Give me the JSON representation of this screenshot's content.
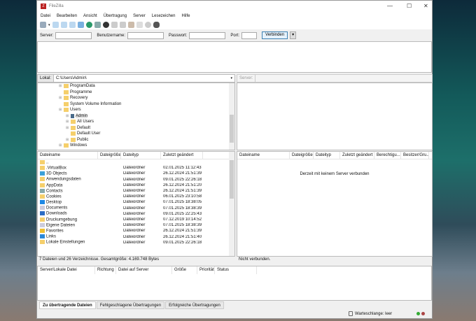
{
  "app": {
    "title": "FileZilla"
  },
  "menu": [
    "Datei",
    "Bearbeiten",
    "Ansicht",
    "Übertragung",
    "Server",
    "Lesezeichen",
    "Hilfe"
  ],
  "quickconnect": {
    "server_label": "Server:",
    "user_label": "Benutzername:",
    "pass_label": "Passwort:",
    "port_label": "Port:",
    "connect": "Verbinden",
    "server": "",
    "user": "",
    "pass": "",
    "port": ""
  },
  "local": {
    "label": "Lokal:",
    "path": "C:\\Users\\Admin\\",
    "tree": [
      {
        "name": "ProgramData",
        "level": 1,
        "exp": "+"
      },
      {
        "name": "Programme",
        "level": 1,
        "exp": ""
      },
      {
        "name": "Recovery",
        "level": 1,
        "exp": "+"
      },
      {
        "name": "System Volume Information",
        "level": 1,
        "exp": ""
      },
      {
        "name": "Users",
        "level": 1,
        "exp": "-"
      },
      {
        "name": "Admin",
        "level": 2,
        "exp": "+",
        "user": true
      },
      {
        "name": "All Users",
        "level": 2,
        "exp": "+"
      },
      {
        "name": "Default",
        "level": 2,
        "exp": "+"
      },
      {
        "name": "Default User",
        "level": 2,
        "exp": ""
      },
      {
        "name": "Public",
        "level": 2,
        "exp": "+"
      },
      {
        "name": "Windows",
        "level": 1,
        "exp": "+"
      }
    ],
    "columns": [
      "Dateiname",
      "Dateigröße",
      "Dateityp",
      "Zuletzt geändert"
    ],
    "files": [
      {
        "name": "..",
        "type": "",
        "date": ""
      },
      {
        "name": ".VirtualBox",
        "type": "Dateiordner",
        "date": "02.01.2025 11:12:43"
      },
      {
        "name": "3D Objects",
        "type": "Dateiordner",
        "date": "26.12.2024 21:51:39"
      },
      {
        "name": "Anwendungsdaten",
        "type": "Dateiordner",
        "date": "09.01.2025 22:26:18"
      },
      {
        "name": "AppData",
        "type": "Dateiordner",
        "date": "26.12.2024 21:51:20"
      },
      {
        "name": "Contacts",
        "type": "Dateiordner",
        "date": "26.12.2024 21:51:39"
      },
      {
        "name": "Cookies",
        "type": "Dateiordner",
        "date": "06.01.2025 23:10:58"
      },
      {
        "name": "Desktop",
        "type": "Dateiordner",
        "date": "07.01.2025 18:38:05"
      },
      {
        "name": "Documents",
        "type": "Dateiordner",
        "date": "07.01.2025 18:38:39"
      },
      {
        "name": "Downloads",
        "type": "Dateiordner",
        "date": "09.01.2025 22:25:43"
      },
      {
        "name": "Druckumgebung",
        "type": "Dateiordner",
        "date": "07.12.2019 10:14:52"
      },
      {
        "name": "Eigene Dateien",
        "type": "Dateiordner",
        "date": "07.01.2025 18:38:39"
      },
      {
        "name": "Favorites",
        "type": "Dateiordner",
        "date": "26.12.2024 21:51:39"
      },
      {
        "name": "Links",
        "type": "Dateiordner",
        "date": "26.12.2024 21:51:40"
      },
      {
        "name": "Lokale Einstellungen",
        "type": "Dateiordner",
        "date": "09.01.2025 22:26:18"
      }
    ],
    "status": "7 Dateien und 26 Verzeichnisse. Gesamtgröße: 4.169.748 Bytes"
  },
  "remote": {
    "label": "Server:",
    "columns": [
      "Dateiname",
      "Dateigröße",
      "Dateityp",
      "Zuletzt geändert",
      "Berechtigu...",
      "Besitzer/Gru..."
    ],
    "empty": "Derzeit mit keinem Server verbunden",
    "status": "Nicht verbunden."
  },
  "queue": {
    "columns": [
      "Server/Lokale Datei",
      "Richtung",
      "Datei auf Server",
      "Größe",
      "Priorität",
      "Status"
    ],
    "tabs": [
      "Zu übertragende Dateien",
      "Fehlgeschlagene Übertragungen",
      "Erfolgreiche Übertragungen"
    ],
    "status": "Warteschlange: leer"
  }
}
